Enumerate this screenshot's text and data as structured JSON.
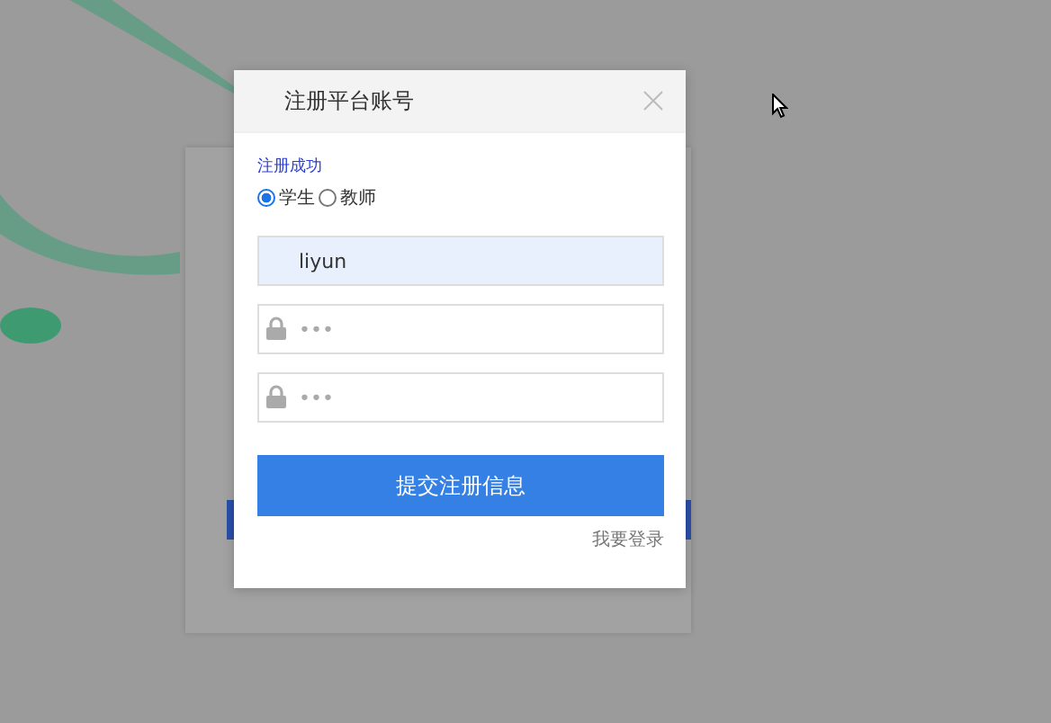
{
  "dialog": {
    "title": "注册平台账号",
    "message": "注册成功",
    "roles": [
      {
        "label": "学生",
        "selected": true
      },
      {
        "label": "教师",
        "selected": false
      }
    ],
    "fields": [
      {
        "kind": "text",
        "value": "liyun"
      },
      {
        "kind": "password",
        "placeholder": "•••"
      },
      {
        "kind": "password",
        "placeholder": "•••"
      }
    ],
    "submit": "提交注册信息",
    "login_link": "我要登录"
  }
}
